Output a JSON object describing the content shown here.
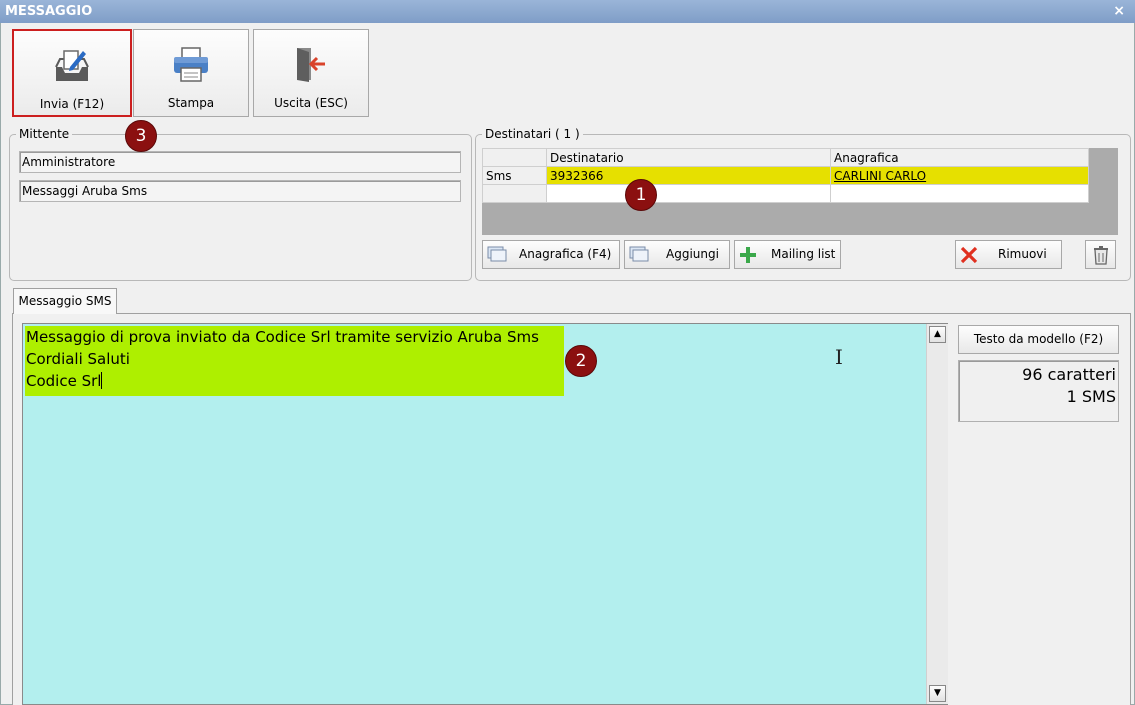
{
  "window": {
    "title": "MESSAGGIO",
    "close_glyph": "×"
  },
  "toolbar": {
    "send_label": "Invia (F12)",
    "print_label": "Stampa",
    "exit_label": "Uscita (ESC)"
  },
  "sender": {
    "legend": "Mittente",
    "user": "Amministratore",
    "service": "Messaggi Aruba Sms"
  },
  "recipients": {
    "legend": "Destinatari ( 1 )",
    "columns": [
      "Destinatario",
      "Anagrafica"
    ],
    "rows": [
      {
        "row_header": "Sms",
        "destinatario": "3932366",
        "anagrafica": "CARLINI CARLO"
      }
    ],
    "buttons": {
      "anagrafica": "Anagrafica (F4)",
      "aggiungi": "Aggiungi",
      "mailing": "Mailing list",
      "rimuovi": "Rimuovi"
    }
  },
  "tabs": {
    "sms": "Messaggio SMS"
  },
  "message": {
    "line1": "Messaggio di prova inviato da Codice Srl tramite servizio Aruba Sms",
    "line2": "Cordiali Saluti",
    "line3": "Codice Srl"
  },
  "side": {
    "template_button": "Testo da modello (F2)",
    "chars": "96 caratteri",
    "sms_count": "1 SMS"
  },
  "badges": {
    "b1": "1",
    "b2": "2",
    "b3": "3"
  },
  "colors": {
    "selected_row": "#e6e000",
    "message_bg": "#b3efee",
    "text_highlight": "#aeef00",
    "badge": "#8b1010",
    "active_border": "#cc1f1f"
  }
}
